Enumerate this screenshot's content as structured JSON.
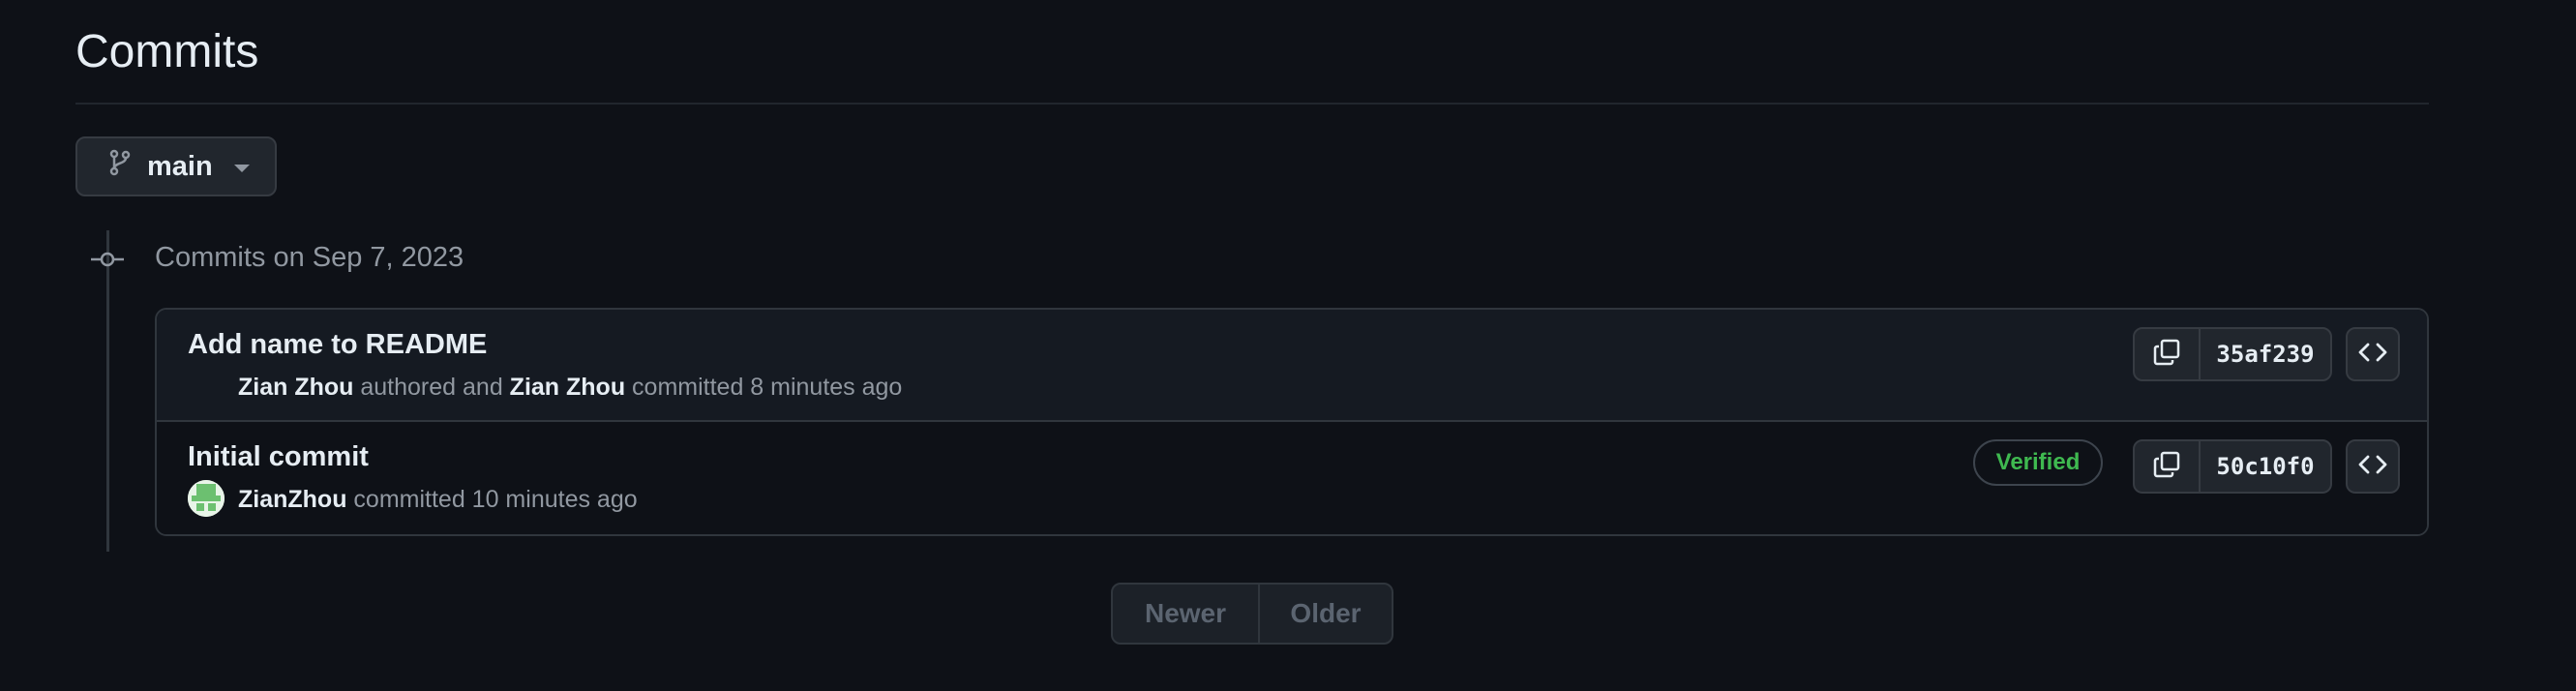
{
  "page": {
    "title": "Commits"
  },
  "branch": {
    "name": "main",
    "icon": "git-branch-icon"
  },
  "timeline": {
    "date_heading": "Commits on Sep 7, 2023"
  },
  "commits": [
    {
      "title": "Add name to README",
      "author": "Zian Zhou",
      "authored_text": " authored and ",
      "committer": "Zian Zhou",
      "committed_text": " committed 8 minutes ago",
      "sha": "35af239"
    },
    {
      "title": "Initial commit",
      "committer": "ZianZhou",
      "committed_text": " committed 10 minutes ago",
      "verified": "Verified",
      "sha": "50c10f0"
    }
  ],
  "pagination": {
    "newer": "Newer",
    "older": "Older"
  },
  "colors": {
    "background": "#0e1117",
    "verified": "#3fb950",
    "muted": "#9198a1"
  }
}
